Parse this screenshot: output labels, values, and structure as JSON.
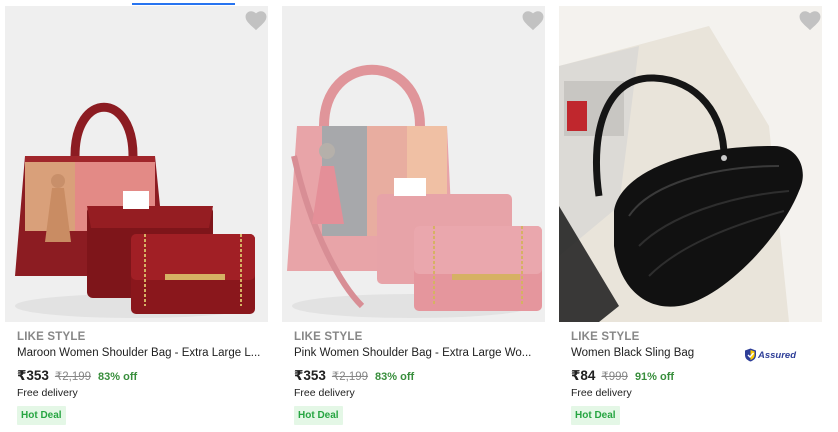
{
  "products": [
    {
      "brand": "LIKE STYLE",
      "title": "Maroon Women Shoulder Bag - Extra Large L...",
      "price": "₹353",
      "mrp": "₹2,199",
      "discount": "83% off",
      "delivery": "Free delivery",
      "badge": "Hot Deal",
      "assured": false,
      "image": "maroon-tri-color-bag-set"
    },
    {
      "brand": "LIKE STYLE",
      "title": "Pink Women Shoulder Bag - Extra Large Wo...",
      "price": "₹353",
      "mrp": "₹2,199",
      "discount": "83% off",
      "delivery": "Free delivery",
      "badge": "Hot Deal",
      "assured": false,
      "image": "pink-grey-bag-set"
    },
    {
      "brand": "LIKE STYLE",
      "title": "Women Black Sling Bag",
      "price": "₹84",
      "mrp": "₹999",
      "discount": "91% off",
      "delivery": "Free delivery",
      "badge": "Hot Deal",
      "assured": true,
      "assured_label": "Assured",
      "image": "black-croc-sling-bag"
    }
  ],
  "colors": {
    "accent": "#2874f0",
    "discount": "#388e3c",
    "badge_bg": "#e4f7e6",
    "badge_text": "#26a541",
    "wishlist": "#c2c2c2"
  },
  "icons": {
    "wishlist": "heart-icon",
    "assured": "shield-check-icon"
  }
}
